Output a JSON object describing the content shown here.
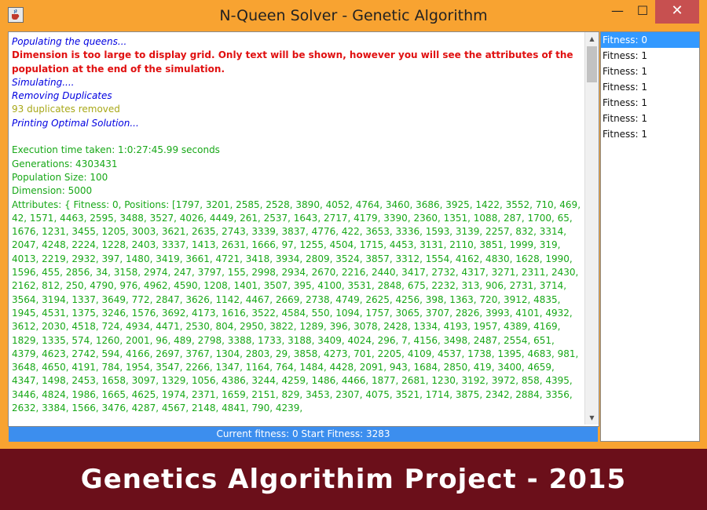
{
  "window": {
    "title": "N-Queen Solver - Genetic Algorithm"
  },
  "output": {
    "line1": "Populating the queens...",
    "line2": "Dimension is too large to display grid. Only text will be shown, however you will see the attributes of the population at the end of the simulation.",
    "line3": "Simulating....",
    "line4": "Removing Duplicates",
    "line5": "93 duplicates removed",
    "line6": "Printing Optimal Solution...",
    "exec_time": "Execution time taken: 1:0:27:45.99 seconds",
    "generations": "Generations: 4303431",
    "population": "Population Size: 100",
    "dimension": "Dimension: 5000",
    "attributes": "Attributes: { Fitness: 0, Positions: [1797, 3201, 2585, 2528, 3890, 4052, 4764, 3460, 3686, 3925, 1422, 3552, 710, 469, 42, 1571, 4463, 2595, 3488, 3527, 4026, 4449, 261, 2537, 1643, 2717, 4179, 3390, 2360, 1351, 1088, 287, 1700, 65, 1676, 1231, 3455, 1205, 3003, 3621, 2635, 2743, 3339, 3837, 4776, 422, 3653, 3336, 1593, 3139, 2257, 832, 3314, 2047, 4248, 2224, 1228, 2403, 3337, 1413, 2631, 1666, 97, 1255, 4504, 1715, 4453, 3131, 2110, 3851, 1999, 319, 4013, 2219, 2932, 397, 1480, 3419, 3661, 4721, 3418, 3934, 2809, 3524, 3857, 3312, 1554, 4162, 4830, 1628, 1990, 1596, 455, 2856, 34, 3158, 2974, 247, 3797, 155, 2998, 2934, 2670, 2216, 2440, 3417, 2732, 4317, 3271, 2311, 2430, 2162, 812, 250, 4790, 976, 4962, 4590, 1208, 1401, 3507, 395, 4100, 3531, 2848, 675, 2232, 313, 906, 2731, 3714, 3564, 3194, 1337, 3649, 772, 2847, 3626, 1142, 4467, 2669, 2738, 4749, 2625, 4256, 398, 1363, 720, 3912, 4835, 1945, 4531, 1375, 3246, 1576, 3692, 4173, 1616, 3522, 4584, 550, 1094, 1757, 3065, 3707, 2826, 3993, 4101, 4932, 3612, 2030, 4518, 724, 4934, 4471, 2530, 804, 2950, 3822, 1289, 396, 3078, 2428, 1334, 4193, 1957, 4389, 4169, 1829, 1335, 574, 1260, 2001, 96, 489, 2798, 3388, 1733, 3188, 3409, 4024, 296, 7, 4156, 3498, 2487, 2554, 651, 4379, 4623, 2742, 594, 4166, 2697, 3767, 1304, 2803, 29, 3858, 4273, 701, 2205, 4109, 4537, 1738, 1395, 4683, 981, 3648, 4650, 4191, 784, 1954, 3547, 2266, 1347, 1164, 764, 1484, 4428, 2091, 943, 1684, 2850, 419, 3400, 4659, 4347, 1498, 2453, 1658, 3097, 1329, 1056, 4386, 3244, 4259, 1486, 4466, 1877, 2681, 1230, 3192, 3972, 858, 4395, 3446, 4824, 1986, 1665, 4625, 1974, 2371, 1659, 2151, 829, 3453, 2307, 4075, 3521, 1714, 3875, 2342, 2884, 3356, 2632, 3384, 1566, 3476, 4287, 4567, 2148, 4841, 790, 4239,"
  },
  "status": "Current fitness: 0 Start Fitness: 3283",
  "fitness_list": [
    "Fitness: 0",
    "Fitness: 1",
    "Fitness: 1",
    "Fitness: 1",
    "Fitness: 1",
    "Fitness: 1",
    "Fitness: 1"
  ],
  "banner": "Genetics Algorithim Project - 2015",
  "colors": {
    "titlebar": "#f8a331",
    "close": "#c75050",
    "status": "#3c8eee",
    "banner": "#6b0f1a",
    "selected": "#3399ff"
  },
  "icons": {
    "app": "java-cup-icon",
    "minimize": "minimize-icon",
    "maximize": "maximize-icon",
    "close": "close-icon"
  }
}
